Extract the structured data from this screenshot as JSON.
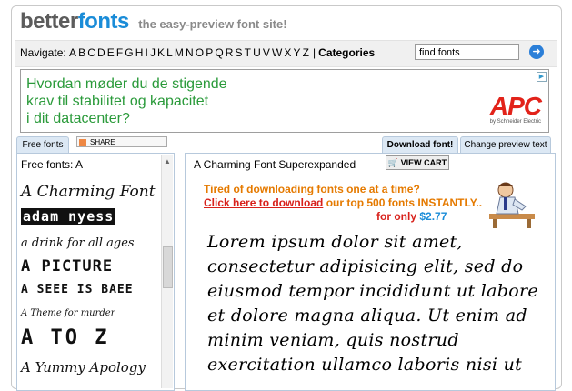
{
  "logo": {
    "brand_a": "better",
    "brand_b": "fonts",
    "tagline": "the easy-preview font site!"
  },
  "nav": {
    "label": "Navigate:",
    "letters": [
      "A",
      "B",
      "C",
      "D",
      "E",
      "F",
      "G",
      "H",
      "I",
      "J",
      "K",
      "L",
      "M",
      "N",
      "O",
      "P",
      "Q",
      "R",
      "S",
      "T",
      "U",
      "V",
      "W",
      "X",
      "Y",
      "Z"
    ],
    "separator": "|",
    "categories": "Categories",
    "search_value": "find fonts"
  },
  "ad": {
    "line1": "Hvordan møder du de stigende",
    "line2": "krav til stabilitet og kapacitet",
    "line3": "i dit datacenter?",
    "brand": "APC",
    "brand_sub": "by Schneider Electric"
  },
  "tabs": {
    "free_fonts": "Free fonts",
    "share": "SHARE",
    "download": "Download font!",
    "preview": "Change preview text"
  },
  "left": {
    "title": "Free fonts: A",
    "samples": [
      "A Charming Font",
      "adam nyess",
      "a drink for all ages",
      "A PICTURE",
      "A SEEE IS BAEE",
      "A Theme for murder",
      "A TO Z",
      "A Yummy Apology"
    ]
  },
  "right": {
    "title": "A Charming Font Superexpanded",
    "view_cart": "VIEW CART",
    "promo_line1": "Tired of downloading fonts one at a time?",
    "promo_link": "Click here to download",
    "promo_rest": "our top 500 fonts INSTANTLY..",
    "promo_only": "for only",
    "promo_price": "$2.77",
    "lorem": "Lorem ipsum dolor sit amet, consectetur adipisicing elit, sed do eiusmod tempor incididunt ut labore et dolore magna aliqua. Ut enim ad minim veniam, quis nostrud exercitation ullamco laboris nisi ut"
  }
}
